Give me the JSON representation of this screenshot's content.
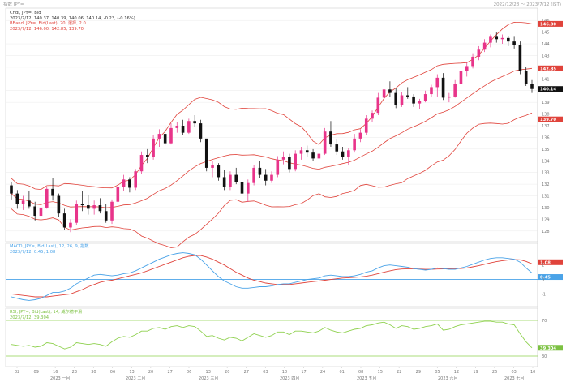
{
  "window": {
    "title_left": "指数 JPY=",
    "title_right": "2022/12/28 ～ 2023/7/12 (JST)"
  },
  "colors": {
    "candle_up": "#e8348a",
    "candle_down": "#111111",
    "band": "#e0433b",
    "macd": "#4aa3e8",
    "signal": "#e0433b",
    "rsi": "#8fd14f",
    "zero_line": "#4aa3e8",
    "panel_border": "#cfcfcf",
    "grid": "#e6e6e6"
  },
  "main_legend": {
    "line1": "Cndl, JPY=, Bid",
    "line2": "2023/7/12, 140.37, 140.39, 140.06, 140.14, -0.23, (-0.16%)",
    "line3": "BBand, JPY=, Bid(Last), 20, 選择, 2.0",
    "line4": "2023/7/12, 146.00, 142.85, 139.70"
  },
  "macd_legend": {
    "line1": "MACD, JPY=, Bid(Last), 12, 26, 9, 指数",
    "line2": "2023/7/12, 0.45, 1.08"
  },
  "rsi_legend": {
    "line1": "RSI, JPY=, Bid(Last), 14, 威尔德平滑",
    "line2": "2023/7/12, 39.304"
  },
  "price_tags": {
    "upper": "146.00",
    "middle": "142.85",
    "close": "140.14",
    "lower": "139.70"
  },
  "macd_tags": {
    "signal": "1.08",
    "macd": "0.45"
  },
  "rsi_tag": "39.304",
  "chart_data": [
    {
      "type": "candlestick",
      "title": "",
      "y_ticks": [
        "146",
        "145",
        "144",
        "143",
        "142",
        "141",
        "140",
        "139",
        "138",
        "137",
        "136",
        "135",
        "134",
        "133",
        "132",
        "131",
        "130",
        "129",
        "128"
      ],
      "ylim": [
        127.5,
        146.5
      ],
      "x_tick_labels": [
        "02",
        "09",
        "16",
        "23",
        "30",
        "06",
        "13",
        "20",
        "27",
        "06",
        "13",
        "20",
        "27",
        "03",
        "10",
        "17",
        "24",
        "01",
        "08",
        "15",
        "22",
        "29",
        "05",
        "12",
        "19",
        "26",
        "03",
        "10"
      ],
      "x_month_labels": [
        "2023 一月",
        "2023 二月",
        "2023 三月",
        "2023 四月",
        "2023 五月",
        "2023 六月",
        "2023 七月"
      ],
      "series": [
        {
          "values": [
            [
              131.9,
              132.2,
              130.7,
              131.2
            ],
            [
              131.2,
              131.5,
              129.9,
              130.3
            ],
            [
              130.3,
              131.0,
              129.8,
              130.6
            ],
            [
              130.6,
              131.4,
              129.9,
              130.1
            ],
            [
              130.1,
              130.5,
              128.9,
              129.3
            ],
            [
              129.3,
              130.3,
              129.0,
              130.0
            ],
            [
              130.0,
              131.8,
              129.9,
              131.6
            ],
            [
              131.6,
              132.5,
              130.6,
              131.0
            ],
            [
              131.0,
              131.2,
              129.2,
              129.5
            ],
            [
              129.5,
              129.9,
              128.1,
              128.3
            ],
            [
              128.3,
              129.0,
              127.9,
              128.7
            ],
            [
              128.7,
              130.6,
              128.5,
              130.3
            ],
            [
              130.3,
              131.4,
              129.7,
              130.2
            ],
            [
              130.2,
              131.1,
              129.4,
              129.9
            ],
            [
              129.9,
              130.6,
              129.4,
              130.2
            ],
            [
              130.2,
              130.8,
              129.5,
              129.7
            ],
            [
              129.7,
              130.3,
              128.7,
              128.9
            ],
            [
              128.9,
              130.7,
              128.6,
              130.5
            ],
            [
              130.5,
              132.1,
              130.3,
              131.8
            ],
            [
              131.8,
              132.8,
              131.4,
              132.4
            ],
            [
              132.4,
              132.6,
              131.3,
              131.7
            ],
            [
              131.7,
              133.3,
              131.5,
              133.1
            ],
            [
              133.1,
              134.8,
              132.9,
              134.5
            ],
            [
              134.5,
              135.0,
              133.8,
              134.3
            ],
            [
              134.3,
              136.2,
              134.1,
              135.9
            ],
            [
              135.9,
              136.7,
              135.2,
              136.3
            ],
            [
              136.3,
              136.9,
              135.3,
              135.5
            ],
            [
              135.5,
              137.2,
              135.4,
              136.8
            ],
            [
              136.8,
              137.3,
              136.4,
              137.0
            ],
            [
              137.0,
              137.5,
              136.2,
              136.4
            ],
            [
              136.4,
              137.6,
              136.3,
              137.4
            ],
            [
              137.4,
              137.9,
              136.9,
              137.2
            ],
            [
              137.2,
              137.5,
              135.6,
              135.9
            ],
            [
              135.9,
              134.6,
              133.1,
              133.4
            ],
            [
              133.4,
              134.0,
              132.6,
              133.6
            ],
            [
              133.6,
              133.8,
              132.3,
              132.6
            ],
            [
              132.6,
              133.2,
              131.5,
              131.8
            ],
            [
              131.8,
              133.1,
              131.5,
              132.8
            ],
            [
              132.8,
              133.4,
              132.0,
              132.2
            ],
            [
              132.2,
              132.6,
              130.8,
              131.2
            ],
            [
              131.2,
              132.4,
              130.5,
              132.1
            ],
            [
              132.1,
              133.6,
              131.9,
              133.4
            ],
            [
              133.4,
              134.0,
              132.5,
              132.8
            ],
            [
              132.8,
              133.3,
              131.9,
              132.3
            ],
            [
              132.3,
              133.1,
              132.1,
              132.8
            ],
            [
              132.8,
              134.4,
              132.6,
              134.1
            ],
            [
              134.1,
              134.8,
              133.7,
              134.3
            ],
            [
              134.3,
              134.6,
              133.0,
              133.3
            ],
            [
              133.3,
              134.9,
              133.1,
              134.6
            ],
            [
              134.6,
              135.2,
              134.1,
              134.9
            ],
            [
              134.9,
              135.3,
              134.3,
              134.7
            ],
            [
              134.7,
              135.0,
              134.0,
              134.2
            ],
            [
              134.2,
              135.0,
              133.4,
              134.6
            ],
            [
              134.6,
              136.8,
              134.5,
              136.5
            ],
            [
              136.5,
              137.4,
              135.2,
              135.4
            ],
            [
              135.4,
              135.9,
              134.5,
              134.8
            ],
            [
              134.8,
              135.2,
              134.1,
              134.3
            ],
            [
              134.3,
              135.1,
              133.6,
              134.9
            ],
            [
              134.9,
              136.3,
              134.7,
              135.9
            ],
            [
              135.9,
              136.7,
              135.6,
              136.4
            ],
            [
              136.4,
              137.9,
              136.2,
              137.6
            ],
            [
              137.6,
              138.3,
              137.3,
              138.1
            ],
            [
              138.1,
              139.8,
              137.9,
              139.4
            ],
            [
              139.4,
              140.4,
              139.1,
              140.1
            ],
            [
              140.1,
              140.8,
              139.5,
              139.8
            ],
            [
              139.8,
              140.2,
              138.5,
              138.8
            ],
            [
              138.8,
              139.9,
              138.6,
              139.6
            ],
            [
              139.6,
              140.3,
              139.3,
              139.5
            ],
            [
              139.5,
              139.7,
              138.6,
              138.9
            ],
            [
              138.9,
              139.3,
              138.4,
              139.1
            ],
            [
              139.1,
              140.0,
              139.0,
              139.7
            ],
            [
              139.7,
              140.5,
              139.5,
              140.3
            ],
            [
              140.3,
              141.4,
              139.5,
              141.1
            ],
            [
              141.1,
              141.5,
              139.2,
              139.4
            ],
            [
              139.4,
              139.8,
              139.0,
              139.5
            ],
            [
              139.5,
              140.9,
              139.4,
              140.6
            ],
            [
              140.6,
              141.9,
              140.4,
              141.7
            ],
            [
              141.7,
              142.4,
              141.2,
              142.1
            ],
            [
              142.1,
              143.2,
              141.9,
              142.9
            ],
            [
              142.9,
              143.8,
              142.6,
              143.5
            ],
            [
              143.5,
              144.4,
              143.3,
              144.1
            ],
            [
              144.1,
              144.8,
              143.7,
              144.6
            ],
            [
              144.6,
              145.0,
              144.1,
              144.4
            ],
            [
              144.4,
              144.8,
              144.0,
              144.5
            ],
            [
              144.5,
              144.7,
              143.8,
              144.2
            ],
            [
              144.2,
              144.6,
              143.6,
              143.9
            ],
            [
              143.9,
              144.2,
              141.4,
              141.7
            ],
            [
              141.7,
              142.0,
              140.4,
              140.6
            ],
            [
              140.6,
              140.9,
              139.8,
              140.14
            ]
          ]
        }
      ]
    },
    {
      "type": "line",
      "title": "",
      "series": [
        {
          "name": "MACD",
          "values": [
            -1.2,
            -1.3,
            -1.4,
            -1.45,
            -1.4,
            -1.3,
            -1.1,
            -0.9,
            -0.9,
            -0.8,
            -0.6,
            -0.3,
            -0.1,
            0.1,
            0.3,
            0.35,
            0.3,
            0.25,
            0.3,
            0.4,
            0.45,
            0.6,
            0.8,
            1.0,
            1.2,
            1.4,
            1.55,
            1.7,
            1.8,
            1.85,
            1.8,
            1.7,
            1.4,
            1.0,
            0.6,
            0.2,
            -0.1,
            -0.3,
            -0.5,
            -0.6,
            -0.6,
            -0.55,
            -0.5,
            -0.5,
            -0.45,
            -0.35,
            -0.3,
            -0.3,
            -0.2,
            -0.1,
            0.0,
            0.05,
            0.1,
            0.25,
            0.3,
            0.25,
            0.2,
            0.2,
            0.25,
            0.35,
            0.5,
            0.6,
            0.8,
            0.95,
            1.0,
            0.95,
            0.9,
            0.85,
            0.75,
            0.7,
            0.65,
            0.7,
            0.8,
            0.75,
            0.7,
            0.7,
            0.8,
            0.9,
            1.05,
            1.2,
            1.35,
            1.45,
            1.5,
            1.5,
            1.45,
            1.4,
            1.2,
            0.8,
            0.45
          ]
        },
        {
          "name": "Signal",
          "values": [
            -1.0,
            -1.05,
            -1.1,
            -1.15,
            -1.2,
            -1.2,
            -1.2,
            -1.15,
            -1.1,
            -1.05,
            -1.0,
            -0.85,
            -0.7,
            -0.5,
            -0.35,
            -0.2,
            -0.1,
            -0.05,
            0.05,
            0.15,
            0.25,
            0.35,
            0.45,
            0.6,
            0.75,
            0.9,
            1.05,
            1.2,
            1.35,
            1.5,
            1.6,
            1.65,
            1.65,
            1.55,
            1.4,
            1.2,
            1.0,
            0.75,
            0.5,
            0.3,
            0.1,
            -0.05,
            -0.15,
            -0.25,
            -0.3,
            -0.35,
            -0.35,
            -0.35,
            -0.3,
            -0.25,
            -0.2,
            -0.15,
            -0.1,
            -0.05,
            0.0,
            0.05,
            0.1,
            0.12,
            0.15,
            0.18,
            0.22,
            0.3,
            0.4,
            0.5,
            0.6,
            0.68,
            0.72,
            0.74,
            0.74,
            0.72,
            0.7,
            0.7,
            0.72,
            0.73,
            0.74,
            0.75,
            0.76,
            0.8,
            0.87,
            0.95,
            1.05,
            1.15,
            1.23,
            1.3,
            1.35,
            1.38,
            1.36,
            1.25,
            1.08
          ]
        }
      ]
    },
    {
      "type": "line",
      "title": "",
      "series": [
        {
          "name": "RSI",
          "values": [
            43,
            42,
            41,
            42,
            40,
            41,
            45,
            44,
            41,
            38,
            40,
            45,
            44,
            43,
            44,
            43,
            41,
            46,
            50,
            52,
            51,
            54,
            58,
            58,
            61,
            62,
            60,
            63,
            64,
            62,
            64,
            63,
            58,
            52,
            53,
            50,
            48,
            51,
            50,
            47,
            51,
            55,
            53,
            51,
            53,
            57,
            57,
            54,
            58,
            58,
            57,
            56,
            58,
            62,
            59,
            57,
            56,
            58,
            60,
            61,
            64,
            65,
            67,
            68,
            65,
            61,
            64,
            63,
            60,
            61,
            63,
            64,
            66,
            59,
            60,
            63,
            65,
            66,
            67,
            68,
            69,
            69,
            68,
            68,
            66,
            65,
            55,
            46,
            39.3
          ]
        }
      ],
      "ylim": [
        20,
        80
      ]
    }
  ]
}
